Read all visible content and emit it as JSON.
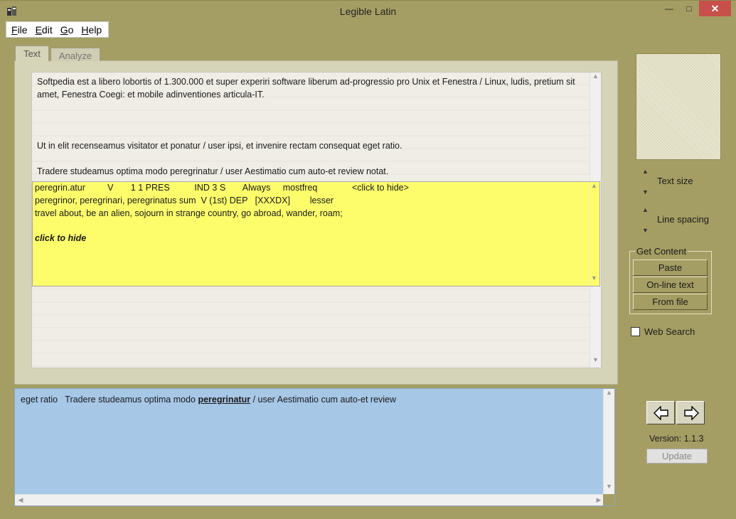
{
  "window": {
    "title": "Legible Latin",
    "minimize": "—",
    "maximize": "□",
    "close": "✕"
  },
  "menu": {
    "items": [
      {
        "underline": "F",
        "rest": "ile"
      },
      {
        "underline": "E",
        "rest": "dit"
      },
      {
        "underline": "G",
        "rest": "o"
      },
      {
        "underline": "H",
        "rest": "elp"
      }
    ]
  },
  "tabs": {
    "text": "Text",
    "analyze": "Analyze"
  },
  "text_content": {
    "p1": "Softpedia est a libero lobortis of 1.300.000 et super experiri software liberum ad-progressio pro Unix et Fenestra / Linux, ludis, pretium sit amet, Fenestra Coegi: et mobile adinventiones articula-IT.",
    "p2": "Ut in elit recenseamus visitator et ponatur / user ipsi, et invenire rectam consequat eget ratio.",
    "p3": "Tradere studeamus optima modo peregrinatur / user Aestimatio cum auto-et review notat."
  },
  "popup": {
    "line1": "peregrin.atur         V       1 1 PRES          IND 3 S       Always     mostfreq              <click to hide>",
    "line2": "peregrinor, peregrinari, peregrinatus sum  V (1st) DEP   [XXXDX]        lesser",
    "line3": "travel about, be an alien, sojourn in strange country, go abroad, wander, roam;",
    "hide": "click to hide"
  },
  "controls": {
    "text_size": "Text size",
    "line_spacing": "Line spacing",
    "get_content": "Get Content",
    "paste": "Paste",
    "online": "On-line text",
    "from_file": "From file",
    "web_search": "Web Search",
    "web_search_checked": false
  },
  "context": {
    "before": "eget ratio   Tradere studeamus optima modo ",
    "word": "peregrinatur",
    "after": " / user Aestimatio cum auto-et review"
  },
  "footer": {
    "version": "Version:  1.1.3",
    "update": "Update"
  },
  "icons": {
    "up": "▲",
    "down": "▼",
    "left": "◀",
    "right": "▶"
  },
  "colors": {
    "window_bg": "#a59e64",
    "popup_bg": "#fdfd6c",
    "context_bg": "#a7c7e7",
    "close_btn": "#c7504b"
  }
}
